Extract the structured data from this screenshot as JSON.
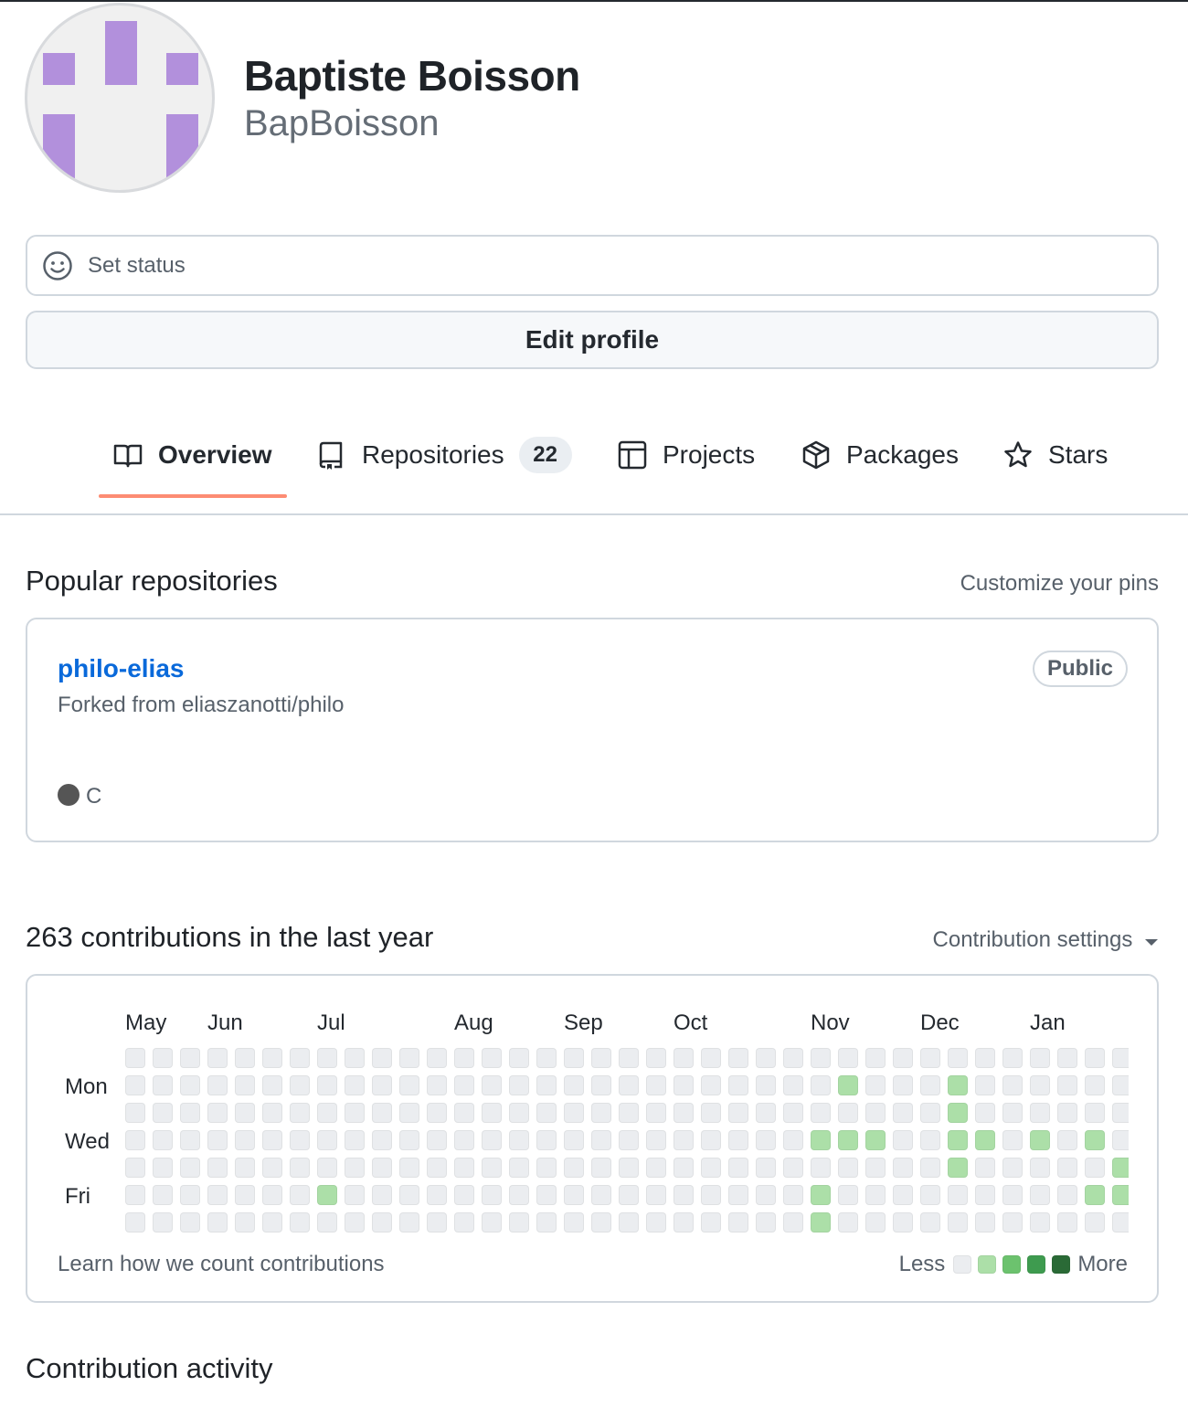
{
  "profile": {
    "name": "Baptiste Boisson",
    "login": "BapBoisson",
    "set_status": "Set status",
    "edit_profile": "Edit profile"
  },
  "tabs": [
    {
      "label": "Overview",
      "icon": "book-icon",
      "active": true
    },
    {
      "label": "Repositories",
      "icon": "repo-icon",
      "count": "22"
    },
    {
      "label": "Projects",
      "icon": "table-icon"
    },
    {
      "label": "Packages",
      "icon": "package-icon"
    },
    {
      "label": "Stars",
      "icon": "star-icon"
    }
  ],
  "popular": {
    "title": "Popular repositories",
    "customize": "Customize your pins",
    "repo": {
      "name": "philo-elias",
      "fork_text": "Forked from eliaszanotti/philo",
      "visibility": "Public",
      "language": "C",
      "language_color": "#555555"
    }
  },
  "contributions": {
    "title": "263 contributions in the last year",
    "settings": "Contribution settings",
    "months": [
      "May",
      "Jun",
      "Jul",
      "Aug",
      "Sep",
      "Oct",
      "Nov",
      "Dec",
      "Jan"
    ],
    "days": [
      "Mon",
      "Wed",
      "Fri"
    ],
    "learn": "Learn how we count contributions",
    "legend_less": "Less",
    "legend_more": "More",
    "colors": [
      "#ebedf0",
      "#acdfa8",
      "#6cc26e",
      "#3e9b4f",
      "#2a6a36"
    ],
    "active_cells": [
      {
        "week": 7,
        "day": 5,
        "level": 1
      },
      {
        "week": 25,
        "day": 3,
        "level": 1
      },
      {
        "week": 25,
        "day": 5,
        "level": 1
      },
      {
        "week": 25,
        "day": 6,
        "level": 1
      },
      {
        "week": 26,
        "day": 1,
        "level": 1
      },
      {
        "week": 26,
        "day": 3,
        "level": 1
      },
      {
        "week": 27,
        "day": 3,
        "level": 1
      },
      {
        "week": 30,
        "day": 1,
        "level": 1
      },
      {
        "week": 30,
        "day": 2,
        "level": 1
      },
      {
        "week": 30,
        "day": 3,
        "level": 1
      },
      {
        "week": 30,
        "day": 4,
        "level": 1
      },
      {
        "week": 31,
        "day": 3,
        "level": 1
      },
      {
        "week": 33,
        "day": 3,
        "level": 1
      },
      {
        "week": 35,
        "day": 3,
        "level": 1
      },
      {
        "week": 35,
        "day": 5,
        "level": 1
      },
      {
        "week": 36,
        "day": 4,
        "level": 1
      },
      {
        "week": 36,
        "day": 5,
        "level": 1
      }
    ]
  },
  "activity": {
    "title": "Contribution activity"
  }
}
